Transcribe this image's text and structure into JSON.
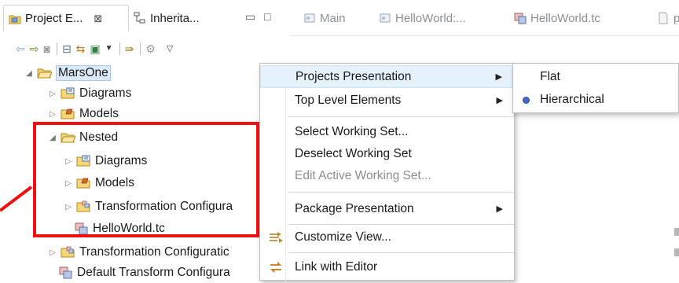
{
  "tabs": {
    "project_explorer": "Project E...",
    "project_explorer_close": "⊠",
    "inheritance": "Inherita...",
    "editors": [
      "Main",
      "HelloWorld:...",
      "HelloWorld.tc",
      "p"
    ]
  },
  "view_buttons": {
    "minimize": "▭",
    "maximize": "□"
  },
  "tree": {
    "root": "MarsOne",
    "items": [
      {
        "label": "Diagrams"
      },
      {
        "label": "Models"
      },
      {
        "label": "Nested"
      },
      {
        "label": "Diagrams"
      },
      {
        "label": "Models"
      },
      {
        "label": "Transformation Configura"
      },
      {
        "label": "HelloWorld.tc"
      },
      {
        "label": "Transformation Configuratic"
      },
      {
        "label": "Default Transform Configura"
      }
    ]
  },
  "context_menu": {
    "items": [
      {
        "label": "Projects Presentation"
      },
      {
        "label": "Top Level Elements"
      },
      {
        "label": "Select Working Set..."
      },
      {
        "label": "Deselect Working Set"
      },
      {
        "label": "Edit Active Working Set..."
      },
      {
        "label": "Package Presentation"
      },
      {
        "label": "Customize View..."
      },
      {
        "label": "Link with Editor"
      }
    ]
  },
  "submenu": {
    "items": [
      {
        "label": "Flat"
      },
      {
        "label": "Hierarchical"
      }
    ],
    "selected": "Hierarchical"
  },
  "colors": {
    "highlight": "#ee1111",
    "selection": "#dbe9f8",
    "radio": "#4a66c8",
    "menu_hover": "#e5f1fb"
  }
}
